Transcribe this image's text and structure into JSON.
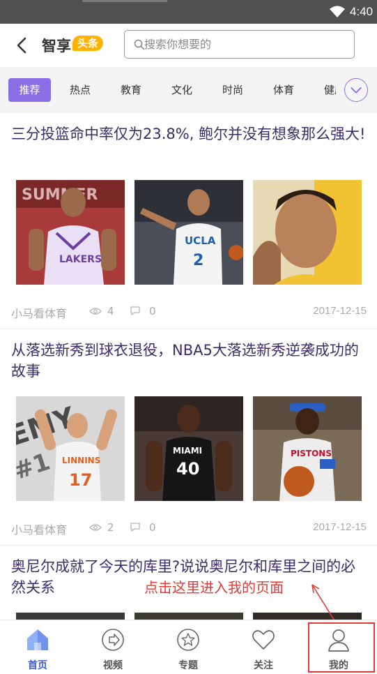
{
  "status_bar": {
    "time": "4:40"
  },
  "header": {
    "logo_text": "智享",
    "logo_badge": "头条",
    "search_placeholder": "搜索你想要的"
  },
  "tabs": [
    {
      "label": "推荐",
      "active": true
    },
    {
      "label": "热点"
    },
    {
      "label": "教育"
    },
    {
      "label": "文化"
    },
    {
      "label": "时尚"
    },
    {
      "label": "体育"
    },
    {
      "label": "健康"
    }
  ],
  "articles": [
    {
      "title": "三分投篮命中率仅为23.8%, 鲍尔并没有想象那么强大!",
      "source": "小马看体育",
      "views": "4",
      "comments": "0",
      "date": "2017-12-15",
      "images": [
        "Lakers player in purple jersey",
        "UCLA player #2 in white jersey",
        "Player portrait close-up"
      ]
    },
    {
      "title": "从落选新秀到球衣退役，NBA5大落选新秀逆袭成功的故事",
      "source": "小马看体育",
      "views": "2",
      "comments": "0",
      "date": "2017-12-15",
      "images": [
        "Knicks player #17 celebrating",
        "Miami player #40 in black jersey",
        "Pistons player with basketball"
      ]
    },
    {
      "title": "奥尼尔成就了今天的库里?说说奥尼尔和库里之间的必然关系"
    }
  ],
  "annotation": {
    "text": "点击这里进入我的页面"
  },
  "bottom_nav": [
    {
      "label": "首页",
      "icon": "home-icon",
      "active": true
    },
    {
      "label": "视频",
      "icon": "video-icon"
    },
    {
      "label": "专题",
      "icon": "star-icon"
    },
    {
      "label": "关注",
      "icon": "heart-icon"
    },
    {
      "label": "我的",
      "icon": "user-icon"
    }
  ],
  "colors": {
    "accent": "#8b6fe6",
    "title_text": "#3a2d6b",
    "nav_active": "#3b5fd9",
    "badge": "#ffb300",
    "annotation": "#e53935"
  }
}
